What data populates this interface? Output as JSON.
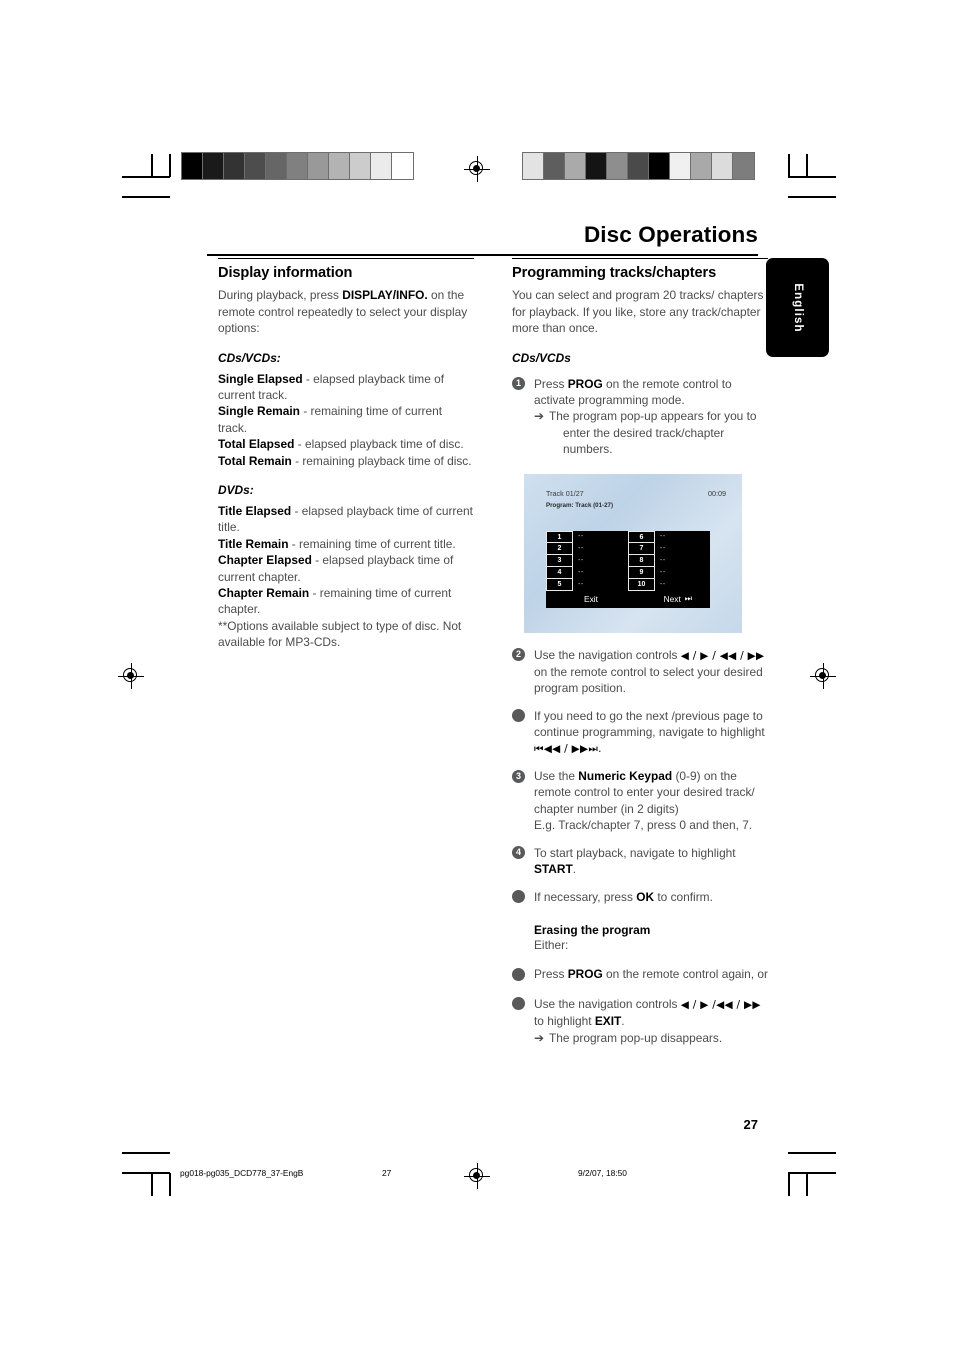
{
  "page_title": "Disc Operations",
  "language_tab": "English",
  "calibration": {
    "left_strip": [
      "#000000",
      "#1a1a1a",
      "#333333",
      "#4d4d4d",
      "#666666",
      "#808080",
      "#999999",
      "#b3b3b3",
      "#cccccc",
      "#ebebeb",
      "#ffffff"
    ],
    "right_strip": [
      "#e3e3e3",
      "#5e5e5e",
      "#aaaaaa",
      "#141414",
      "#8e8e8e",
      "#4a4a4a",
      "#000000",
      "#f0f0f0",
      "#a9a9a9",
      "#dcdcdc",
      "#7d7d7d"
    ]
  },
  "left_column": {
    "heading": "Display information",
    "intro_pre": "During playback, press ",
    "intro_bold": "DISPLAY/INFO.",
    "intro_post": " on the remote control repeatedly to select your display options:",
    "cdvcd_subhead": "CDs/VCDs:",
    "cdvcd_items": [
      {
        "term": "Single Elapsed",
        "desc": " - elapsed playback time of current track."
      },
      {
        "term": "Single Remain",
        "desc": " - remaining time of current track."
      },
      {
        "term": "Total Elapsed",
        "desc": " - elapsed playback time of disc."
      },
      {
        "term": "Total Remain",
        "desc": " - remaining playback time of disc."
      }
    ],
    "dvd_subhead": "DVDs:",
    "dvd_items": [
      {
        "term": "Title Elapsed",
        "desc": " - elapsed playback time of current title."
      },
      {
        "term": "Title Remain",
        "desc": " - remaining time of current title."
      },
      {
        "term": "Chapter Elapsed",
        "desc": " - elapsed playback time of current chapter."
      },
      {
        "term": "Chapter Remain",
        "desc": " - remaining time of current chapter."
      }
    ],
    "footnote": "**Options available subject to type of disc. Not available for MP3-CDs."
  },
  "right_column": {
    "heading": "Programming tracks/chapters",
    "intro": "You can select and program 20 tracks/ chapters for playback.  If you like, store any track/chapter more than once.",
    "cdvcd_subhead": "CDs/VCDs",
    "step1": {
      "marker": "1",
      "pre": "Press ",
      "bold": "PROG",
      "post": " on the remote control to activate programming mode.",
      "arrow": "➔",
      "arrow_text": "The program pop-up appears for you to",
      "arrow_text2": "enter the desired track/chapter numbers."
    },
    "tv_screen": {
      "track_label": "Track 01/27",
      "time": "00:09",
      "program_label": "Program: Track (01-27)",
      "slots_left": [
        "1",
        "2",
        "3",
        "4",
        "5"
      ],
      "slots_right": [
        "6",
        "7",
        "8",
        "9",
        "10"
      ],
      "slot_placeholder": "--",
      "exit_label": "Exit",
      "next_label": "Next",
      "next_icon": "⏭"
    },
    "step2": {
      "marker": "2",
      "pre": "Use the navigation controls ",
      "symbols": "◀ / ▶ / ◀◀ /  ▶▶",
      "post": " on the remote control to select your desired program position."
    },
    "bullet1": {
      "text": "If you need to go the next /previous page to continue programming, navigate to highlight",
      "symbols": "⏮◀◀ / ▶▶⏭."
    },
    "step3": {
      "marker": "3",
      "pre": "Use the ",
      "bold": "Numeric Keypad",
      "post": " (0-9) on the remote control to enter your desired track/ chapter number (in 2 digits)",
      "example": "E.g. Track/chapter 7, press 0 and then, 7."
    },
    "step4": {
      "marker": "4",
      "pre": "To start playback, navigate  to highlight ",
      "bold": "START",
      "post": "."
    },
    "bullet2": {
      "pre": "If necessary,  press ",
      "bold": "OK",
      "post": " to confirm."
    },
    "erasing": {
      "heading": "Erasing the program",
      "either": "Either:",
      "b1_pre": "Press ",
      "b1_bold": "PROG",
      "b1_post": " on the remote control again, or",
      "b2_pre": "Use the navigation controls ",
      "b2_symbols": "◀ / ▶ /◀◀ /  ▶▶",
      "b2_line2_pre": "to highlight ",
      "b2_bold": "EXIT",
      "b2_post": ".",
      "arrow": "➔",
      "arrow_text": "The program pop-up disappears."
    }
  },
  "footer": {
    "page_number": "27",
    "file_name": "pg018-pg035_DCD778_37-EngB",
    "page_marker": "27",
    "timestamp": "9/2/07, 18:50"
  }
}
